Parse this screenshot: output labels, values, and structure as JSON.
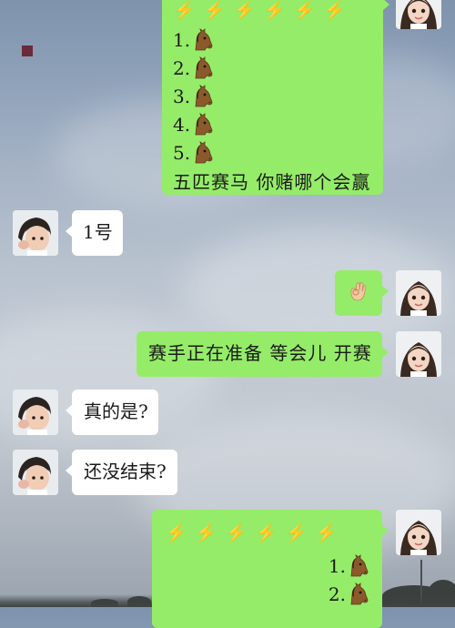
{
  "background": {
    "sky_top": "#7f93ad",
    "sky_bottom": "#9aa3ae"
  },
  "colors": {
    "sent_bubble": "#95ec69",
    "received_bubble": "#ffffff",
    "bolt": "#f2c230",
    "text": "#1a1a1a"
  },
  "messages": [
    {
      "id": "msg-race-announcement",
      "sender": "self",
      "bolts": [
        "⚡",
        "⚡",
        "⚡",
        "⚡",
        "⚡",
        "⚡"
      ],
      "horse_lines": [
        "1.",
        "2.",
        "3.",
        "4.",
        "5."
      ],
      "horse_icon": "horse-face-icon",
      "text": "五匹赛马 你赌哪个会赢"
    },
    {
      "id": "msg-pick-one",
      "sender": "other",
      "text": "1号"
    },
    {
      "id": "msg-ok",
      "sender": "self",
      "emoji": "👌",
      "emoji_icon": "ok-hand-icon"
    },
    {
      "id": "msg-preparing",
      "sender": "self",
      "text": "赛手正在准备 等会儿 开赛"
    },
    {
      "id": "msg-really",
      "sender": "other",
      "text": "真的是?"
    },
    {
      "id": "msg-not-over",
      "sender": "other",
      "text": "还没结束?"
    },
    {
      "id": "msg-race-update",
      "sender": "self",
      "bolts": [
        "⚡",
        "⚡",
        "⚡",
        "⚡",
        "⚡",
        "⚡"
      ],
      "horse_lines": [
        "1.",
        "2."
      ],
      "horse_icon": "horse-face-icon"
    }
  ]
}
